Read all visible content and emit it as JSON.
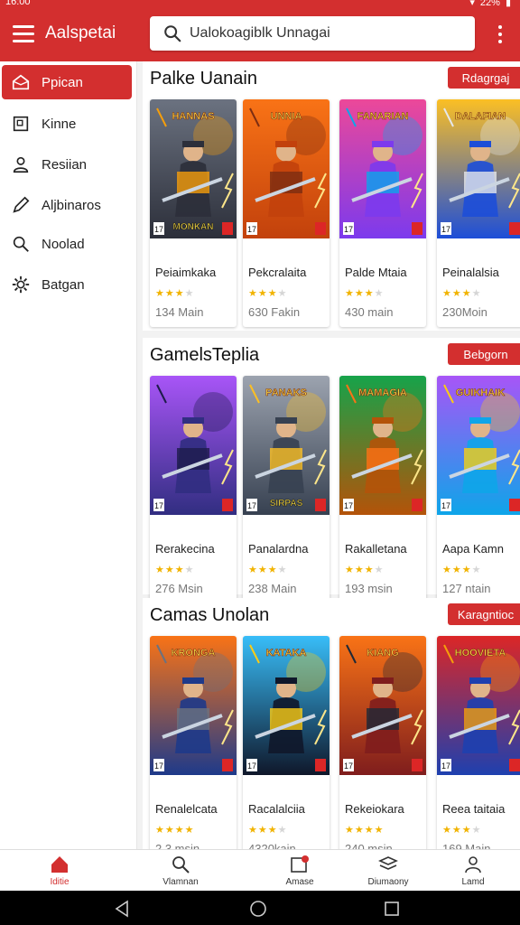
{
  "status": {
    "time": "16:00",
    "battery": "22%"
  },
  "header": {
    "title": "Aalspetai",
    "search_value": "Ualokoagiblk Unnagai"
  },
  "sidebar": {
    "items": [
      {
        "label": "Ppican",
        "icon": "home-outline-icon",
        "active": true
      },
      {
        "label": "Kinne",
        "icon": "square-icon"
      },
      {
        "label": "Resiian",
        "icon": "person-icon"
      },
      {
        "label": "Aljbinaros",
        "icon": "pencil-icon"
      },
      {
        "label": "Noolad",
        "icon": "search-icon"
      },
      {
        "label": "Batgan",
        "icon": "gear-icon"
      }
    ]
  },
  "sections": [
    {
      "title": "Palke Uanain",
      "button": "Rdagrgaj",
      "cards": [
        {
          "name": "Peiaimkaka",
          "meta": "134 Main",
          "rating": 3,
          "cover_title": "HANNAS MONKAN",
          "palette": [
            "#2c2f3a",
            "#6b7280",
            "#f59e0b"
          ]
        },
        {
          "name": "Pekcralaita",
          "meta": "630 Fakin",
          "rating": 3,
          "cover_title": "UNNIA",
          "palette": [
            "#c2410c",
            "#f97316",
            "#7c2d12"
          ]
        },
        {
          "name": "Palde Mtaia",
          "meta": "430 main",
          "rating": 3,
          "cover_title": "FANARIAN",
          "palette": [
            "#7c3aed",
            "#ec4899",
            "#0ea5e9"
          ]
        },
        {
          "name": "Peinalalsia",
          "meta": "230Moin",
          "rating": 3,
          "cover_title": "DALAFIAN",
          "palette": [
            "#1d4ed8",
            "#fbbf24",
            "#e5e7eb"
          ]
        }
      ]
    },
    {
      "title": "GamelsTeplia",
      "button": "Bebgorn",
      "cards": [
        {
          "name": "Rerakecina",
          "meta": "276 Msin",
          "rating": 3,
          "cover_title": "",
          "palette": [
            "#312e81",
            "#a855f7",
            "#1e1b4b"
          ]
        },
        {
          "name": "Panalardna",
          "meta": "238 Main",
          "rating": 3,
          "cover_title": "PANAKS SIRPAS",
          "palette": [
            "#374151",
            "#9ca3af",
            "#fbbf24"
          ]
        },
        {
          "name": "Rakalletana",
          "meta": "193 msin",
          "rating": 3,
          "cover_title": "MAMAGIA",
          "palette": [
            "#b45309",
            "#16a34a",
            "#f97316"
          ]
        },
        {
          "name": "Aapa Kamn",
          "meta": "127 ntain",
          "rating": 3,
          "cover_title": "GUIKHAIK",
          "palette": [
            "#0ea5e9",
            "#a855f7",
            "#facc15"
          ]
        }
      ]
    },
    {
      "title": "Camas Unolan",
      "button": "Karagntioc",
      "cards": [
        {
          "name": "Renalelcata",
          "meta": "2,3 msin",
          "rating": 4,
          "cover_title": "KRONGA",
          "palette": [
            "#1e3a8a",
            "#f97316",
            "#6b7280"
          ]
        },
        {
          "name": "Racalalciia",
          "meta": "4320kain",
          "rating": 3,
          "cover_title": "KATAKA",
          "palette": [
            "#0f172a",
            "#38bdf8",
            "#facc15"
          ]
        },
        {
          "name": "Rekeiokara",
          "meta": "240 msin",
          "rating": 4,
          "cover_title": "KIANG",
          "palette": [
            "#7f1d1d",
            "#f97316",
            "#1f2937"
          ]
        },
        {
          "name": "Reea taitaia",
          "meta": "169 Main",
          "rating": 3,
          "cover_title": "HOOVIETA",
          "palette": [
            "#1e40af",
            "#dc2626",
            "#f59e0b"
          ]
        }
      ]
    }
  ],
  "bottom_nav": [
    {
      "label": "Iditie",
      "icon": "home-icon",
      "active": true
    },
    {
      "label": "Vlamnan",
      "icon": "search-icon"
    },
    {
      "label": "Amase",
      "icon": "inbox-icon"
    },
    {
      "label": "Diumaony",
      "icon": "layers-icon"
    },
    {
      "label": "Lamd",
      "icon": "profile-icon"
    }
  ],
  "colors": {
    "accent": "#d32f2f",
    "star": "#f1b300",
    "panel": "#f2f2f2"
  }
}
